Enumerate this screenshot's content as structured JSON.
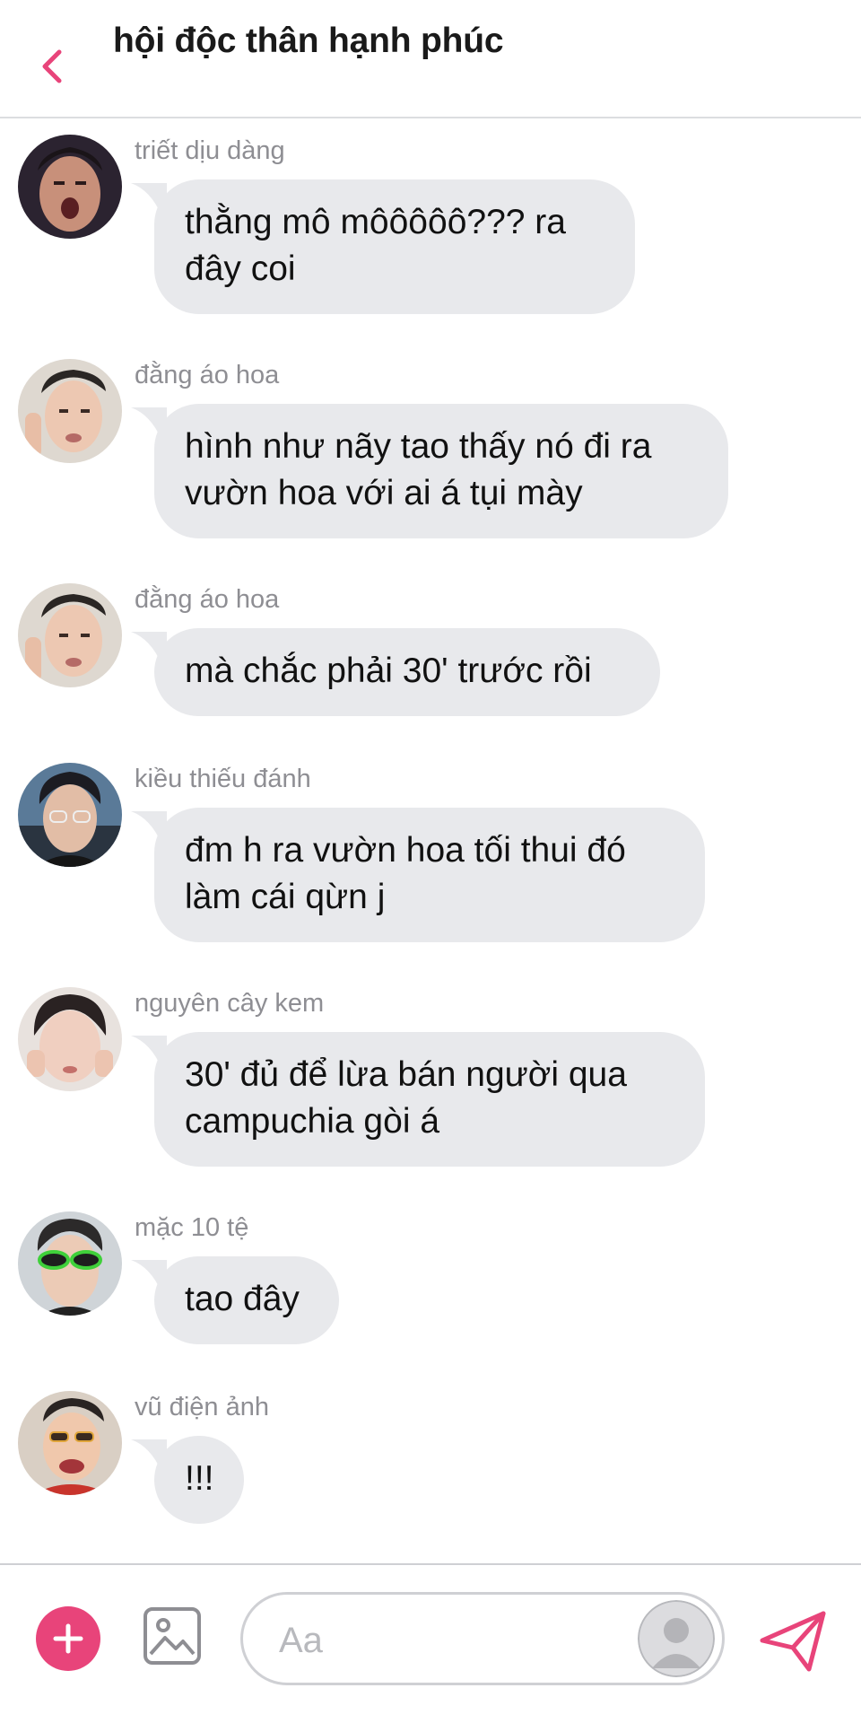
{
  "header": {
    "title": "hội độc thân hạnh phúc",
    "back_icon": "chevron-left-icon",
    "accent_color": "#e8447a"
  },
  "messages": [
    {
      "sender": "triết dịu dàng",
      "lines": [
        "thằng mô môôôôô??? ra",
        "đây coi"
      ]
    },
    {
      "sender": "đằng áo hoa",
      "lines": [
        "hình như nãy tao thấy nó đi ra",
        "vườn hoa với ai á tụi mày"
      ]
    },
    {
      "sender": "đằng áo hoa",
      "lines": [
        "mà chắc phải 30' trước rồi"
      ]
    },
    {
      "sender": "kiều thiếu đánh",
      "lines": [
        "đm h ra vườn hoa tối thui đó",
        "làm cái qừn j"
      ]
    },
    {
      "sender": "nguyên cây kem",
      "lines": [
        "30' đủ để lừa bán người qua",
        "campuchia gòi á"
      ]
    },
    {
      "sender": "mặc 10 tệ",
      "lines": [
        "tao đây"
      ]
    },
    {
      "sender": "vũ điện ảnh",
      "lines": [
        "!!!"
      ]
    }
  ],
  "composer": {
    "placeholder": "Aa",
    "add_icon": "plus-icon",
    "image_icon": "image-icon",
    "send_icon": "send-icon"
  },
  "colors": {
    "bubble": "#e8e9ec",
    "sender_text": "#8e8e93",
    "accent": "#e8447a"
  }
}
